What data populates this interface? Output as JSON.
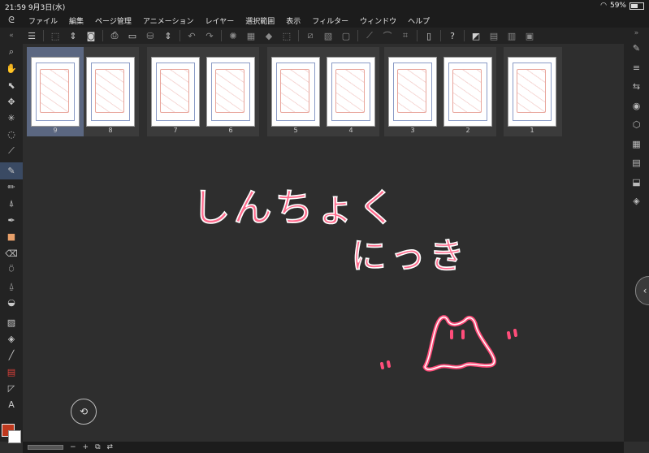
{
  "status": {
    "time": "21:59",
    "date": "9月3日(水)",
    "battery": "59%"
  },
  "menu": [
    "ファイル",
    "編集",
    "ページ管理",
    "アニメーション",
    "レイヤー",
    "選択範囲",
    "表示",
    "フィルター",
    "ウィンドウ",
    "ヘルプ"
  ],
  "pages": {
    "spreads": [
      {
        "left": "9",
        "right": "8",
        "selected_page": "9"
      },
      {
        "left": "7",
        "right": "6"
      },
      {
        "left": "5",
        "right": "4"
      },
      {
        "left": "3",
        "right": "2"
      },
      {
        "left": "1"
      }
    ]
  },
  "canvas_text": {
    "line1": "しんちょく",
    "line2": "にっき"
  },
  "colors": {
    "main": "#c0391e",
    "sub": "#ffffff",
    "accent_selected": "#5b6781",
    "doodle": "#e0245e"
  },
  "bottom": {
    "zoom_minus": "−",
    "zoom_plus": "+"
  },
  "icons": {
    "left_tools": [
      "zoom-icon",
      "hand-icon",
      "operation-icon",
      "move-layer-icon",
      "auto-select-icon",
      "lasso-icon",
      "eyedropper-icon",
      "pen-icon",
      "pencil-icon",
      "brush-icon",
      "marker-icon",
      "airbrush-icon",
      "eraser-icon",
      "blend-icon",
      "fill-icon",
      "bucket-icon",
      "gradient-icon",
      "shape-fill-icon",
      "line-icon",
      "frame-icon",
      "ruler-icon",
      "text-icon"
    ],
    "right_tools": [
      "tool-property-icon",
      "sub-tool-icon",
      "navigator-icon",
      "color-icon",
      "material-icon",
      "layer-property-icon",
      "history-icon",
      "page-export-icon",
      "layers-icon"
    ]
  }
}
